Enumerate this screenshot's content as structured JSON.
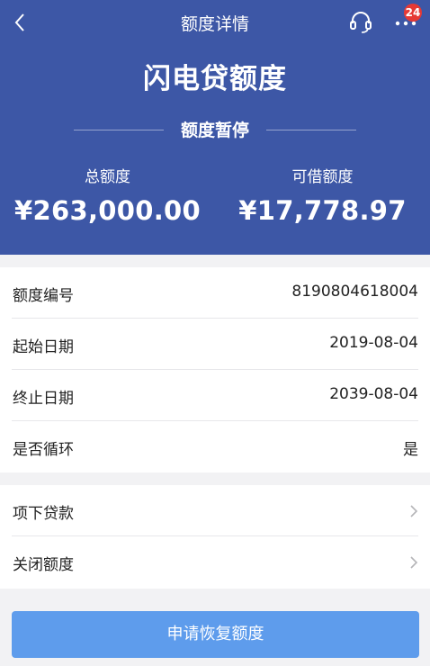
{
  "nav": {
    "title": "额度详情",
    "badge_count": "24",
    "icons": {
      "back": "back-chevron-icon",
      "service": "headset-icon",
      "more": "more-dots-icon"
    }
  },
  "summary": {
    "product_title": "闪电贷额度",
    "status": "额度暂停",
    "total_label": "总额度",
    "total_value": "¥263,000.00",
    "available_label": "可借额度",
    "available_value": "¥17,778.97"
  },
  "details": [
    {
      "label": "额度编号",
      "value": "8190804618004"
    },
    {
      "label": "起始日期",
      "value": "2019-08-04"
    },
    {
      "label": "终止日期",
      "value": "2039-08-04"
    },
    {
      "label": "是否循环",
      "value": "是"
    }
  ],
  "actions": [
    {
      "label": "项下贷款"
    },
    {
      "label": "关闭额度"
    }
  ],
  "primary_button": {
    "label": "申请恢复额度"
  },
  "colors": {
    "header_bg": "#3d57a6",
    "button_bg": "#5e9cec",
    "badge_bg": "#e53935"
  }
}
